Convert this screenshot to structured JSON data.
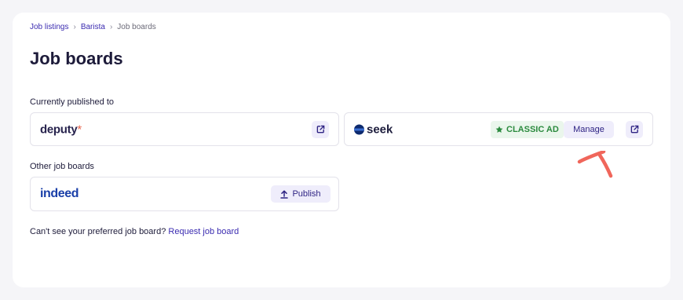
{
  "breadcrumb": {
    "items": [
      "Job listings",
      "Barista"
    ],
    "current": "Job boards"
  },
  "page_title": "Job boards",
  "published": {
    "label": "Currently published to",
    "boards": [
      {
        "name": "deputy",
        "logo_mark": "*"
      },
      {
        "name": "seek",
        "badge": "CLASSIC AD",
        "manage_label": "Manage"
      }
    ]
  },
  "other": {
    "label": "Other job boards",
    "boards": [
      {
        "name": "indeed",
        "publish_label": "Publish"
      }
    ]
  },
  "footer": {
    "text": "Can't see your preferred job board?",
    "link": "Request job board"
  },
  "colors": {
    "accent": "#3a2bb0",
    "badge_green": "#2b8a3e",
    "annotation": "#f0665b"
  },
  "icons": [
    "chevron-right-icon",
    "external-link-icon",
    "star-icon",
    "upload-icon"
  ]
}
